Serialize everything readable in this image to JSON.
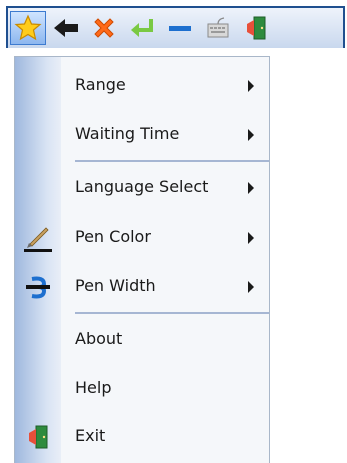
{
  "toolbar": {
    "buttons": [
      {
        "name": "star-icon"
      },
      {
        "name": "back-arrow-icon"
      },
      {
        "name": "close-x-icon"
      },
      {
        "name": "enter-return-icon"
      },
      {
        "name": "minimize-dash-icon"
      },
      {
        "name": "keyboard-icon"
      },
      {
        "name": "exit-door-icon"
      }
    ],
    "colors": {
      "border": "#1f4f8f",
      "active": "#8db7ef"
    }
  },
  "menu": {
    "items": [
      {
        "label": "Range",
        "submenu": true
      },
      {
        "label": "Waiting Time",
        "submenu": true
      },
      {
        "label": "Language Select",
        "submenu": true
      },
      {
        "label": "Pen Color",
        "submenu": true,
        "icon": "pen-color-icon"
      },
      {
        "label": "Pen Width",
        "submenu": true,
        "icon": "pen-width-icon"
      },
      {
        "label": "About",
        "submenu": false
      },
      {
        "label": "Help",
        "submenu": false
      },
      {
        "label": "Exit",
        "submenu": false,
        "icon": "exit-door-icon"
      }
    ]
  }
}
